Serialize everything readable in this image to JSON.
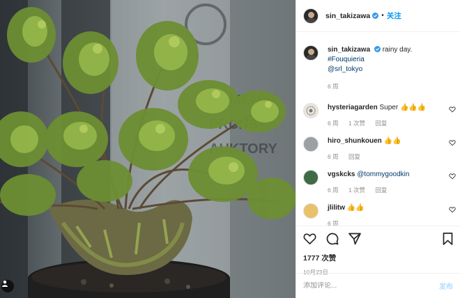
{
  "photo": {
    "alt_icon": "plant-photo",
    "user_tag_icon": "person-icon"
  },
  "header": {
    "username": "sin_takizawa",
    "separator": "•",
    "follow_label": "关注",
    "verified_icon": "verified-badge-icon"
  },
  "caption": {
    "username": "sin_takizawa",
    "text": "rainy day.",
    "hashtag": "#Fouquieria",
    "mention": "@srl_tokyo",
    "age": "6 周"
  },
  "comments": [
    {
      "username": "hysteriagarden",
      "text": "Super 👍👍👍",
      "age": "6 周",
      "likes": "1 次赞",
      "reply": "回复",
      "avatar_color": "#e9e4dc"
    },
    {
      "username": "hiro_shunkouen",
      "text": "👍👍",
      "age": "6 周",
      "likes": "",
      "reply": "回复",
      "avatar_color": "#9aa0a4"
    },
    {
      "username": "vgskcks",
      "text": "@tommygoodkin",
      "age": "6 周",
      "likes": "1 次赞",
      "reply": "回复",
      "avatar_color": "#3e6b45"
    },
    {
      "username": "jlilitw",
      "text": "👍👍",
      "age": "6 周",
      "likes": "",
      "reply": "",
      "avatar_color": "#e8c26a"
    }
  ],
  "actions": {
    "like_count": "1777 次赞",
    "date": "10月23日"
  },
  "composer": {
    "placeholder": "添加评论...",
    "post_label": "发布"
  },
  "colors": {
    "accent": "#0095f6",
    "mention": "#00376b",
    "muted": "#8e8e8e",
    "post_disabled": "#b3dbff"
  }
}
